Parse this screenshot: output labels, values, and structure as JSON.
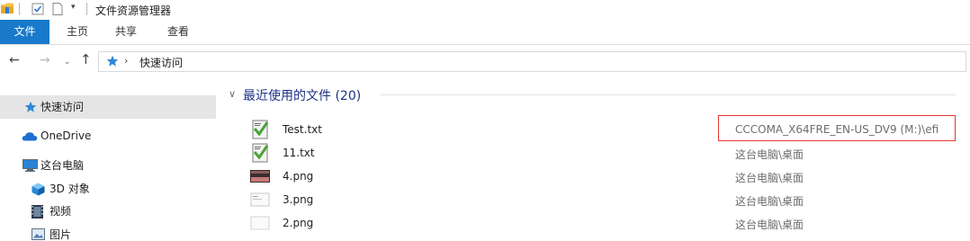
{
  "window": {
    "title": "文件资源管理器",
    "quick_access_toolbar": {
      "items": [
        "folder-icon",
        "properties-check-icon",
        "new-folder-icon",
        "customize-dropdown-icon"
      ],
      "dropdown_glyph": "▾"
    }
  },
  "ribbon": {
    "tabs": [
      {
        "label": "文件",
        "active": true,
        "color": "#1979ca"
      },
      {
        "label": "主页"
      },
      {
        "label": "共享"
      },
      {
        "label": "查看"
      }
    ]
  },
  "navigation": {
    "back": "←",
    "forward": "→",
    "recent": "⌄",
    "up": "↑",
    "address": {
      "icon": "quick-access-star-icon",
      "separator": "›",
      "path": "快速访问"
    }
  },
  "sidebar": {
    "items": [
      {
        "label": "快速访问",
        "icon": "quick-access-star-icon",
        "selected": true
      },
      {
        "label": "OneDrive",
        "icon": "onedrive-cloud-icon"
      },
      {
        "label": "这台电脑",
        "icon": "this-pc-icon"
      },
      {
        "label": "3D 对象",
        "icon": "3d-objects-icon"
      },
      {
        "label": "视频",
        "icon": "videos-icon"
      },
      {
        "label": "图片",
        "icon": "pictures-icon"
      }
    ]
  },
  "content": {
    "group": {
      "chevron": "∨",
      "title": "最近使用的文件 (20)"
    },
    "files": [
      {
        "name": "Test.txt",
        "location": "CCCOMA_X64FRE_EN-US_DV9 (M:)\\efi",
        "icon": "text-file-icon",
        "highlighted": true
      },
      {
        "name": "11.txt",
        "location": "这台电脑\\桌面",
        "icon": "text-file-icon"
      },
      {
        "name": "4.png",
        "location": "这台电脑\\桌面",
        "icon": "image-file-icon"
      },
      {
        "name": "3.png",
        "location": "这台电脑\\桌面",
        "icon": "image-file-icon"
      },
      {
        "name": "2.png",
        "location": "这台电脑\\桌面",
        "icon": "image-file-icon"
      }
    ],
    "highlight_color": "#e2342f"
  }
}
